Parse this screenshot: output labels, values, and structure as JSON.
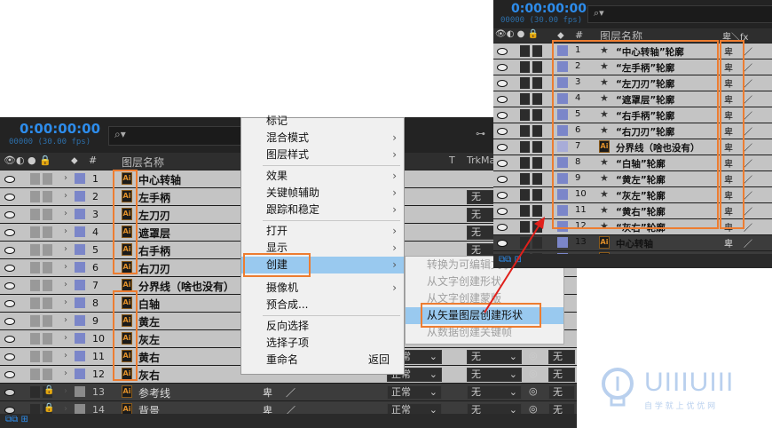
{
  "left": {
    "timecode": "0:00:00:00",
    "fps": "00000 (30.00 fps)",
    "col_layer_name": "图层名称",
    "col_t": "T",
    "col_trkmat": "TrkMa",
    "rows": [
      {
        "num": "1",
        "name": "中心转轴"
      },
      {
        "num": "2",
        "name": "左手柄"
      },
      {
        "num": "3",
        "name": "左刀刃"
      },
      {
        "num": "4",
        "name": "遮罩层"
      },
      {
        "num": "5",
        "name": "右手柄"
      },
      {
        "num": "6",
        "name": "右刀刃"
      },
      {
        "num": "7",
        "name": "分界线（啥也没有）"
      },
      {
        "num": "8",
        "name": "白轴"
      },
      {
        "num": "9",
        "name": "黄左"
      },
      {
        "num": "10",
        "name": "灰左"
      },
      {
        "num": "11",
        "name": "黄右"
      },
      {
        "num": "12",
        "name": "灰右"
      },
      {
        "num": "13",
        "name": "参考线"
      },
      {
        "num": "14",
        "name": "背景"
      }
    ],
    "mode_normal": "正常",
    "trk_none": "无"
  },
  "menu": {
    "items": [
      "标记",
      "混合模式",
      "图层样式",
      "效果",
      "关键帧辅助",
      "跟踪和稳定",
      "打开",
      "显示",
      "创建",
      "摄像机",
      "预合成...",
      "反向选择",
      "选择子项",
      "重命名"
    ],
    "rename_shortcut": "返回"
  },
  "submenu": {
    "items": [
      "转换为可编辑文字",
      "从文字创建形状",
      "从文字创建蒙版",
      "从矢量图层创建形状",
      "从数据创建关键帧"
    ]
  },
  "right": {
    "timecode": "0:00:00:00",
    "fps": "00000 (30.00 fps)",
    "col_layer_name": "图层名称",
    "rows": [
      {
        "num": "1",
        "name": "“中心转轴”轮廓"
      },
      {
        "num": "2",
        "name": "“左手柄”轮廓"
      },
      {
        "num": "3",
        "name": "“左刀刃”轮廓"
      },
      {
        "num": "4",
        "name": "“遮罩层”轮廓"
      },
      {
        "num": "5",
        "name": "“右手柄”轮廓"
      },
      {
        "num": "6",
        "name": "“右刀刃”轮廓"
      },
      {
        "num": "7",
        "name": "分界线（啥也没有）"
      },
      {
        "num": "8",
        "name": "“白轴”轮廓"
      },
      {
        "num": "9",
        "name": "“黄左”轮廓"
      },
      {
        "num": "10",
        "name": "“灰左”轮廓"
      },
      {
        "num": "11",
        "name": "“黄右”轮廓"
      },
      {
        "num": "12",
        "name": "“灰右”轮廓"
      },
      {
        "num": "13",
        "name": "中心转轴"
      },
      {
        "num": "14",
        "name": "左手柄"
      }
    ]
  },
  "watermark": {
    "logo": "UIIIUIII",
    "sub": "自 学 就 上 优 优 网"
  },
  "colors": {
    "accent_orange": "#ed7d31",
    "timecode_blue": "#2d8ceb",
    "menu_highlight": "#99c9ef",
    "label_blue": "#7b86c9"
  }
}
